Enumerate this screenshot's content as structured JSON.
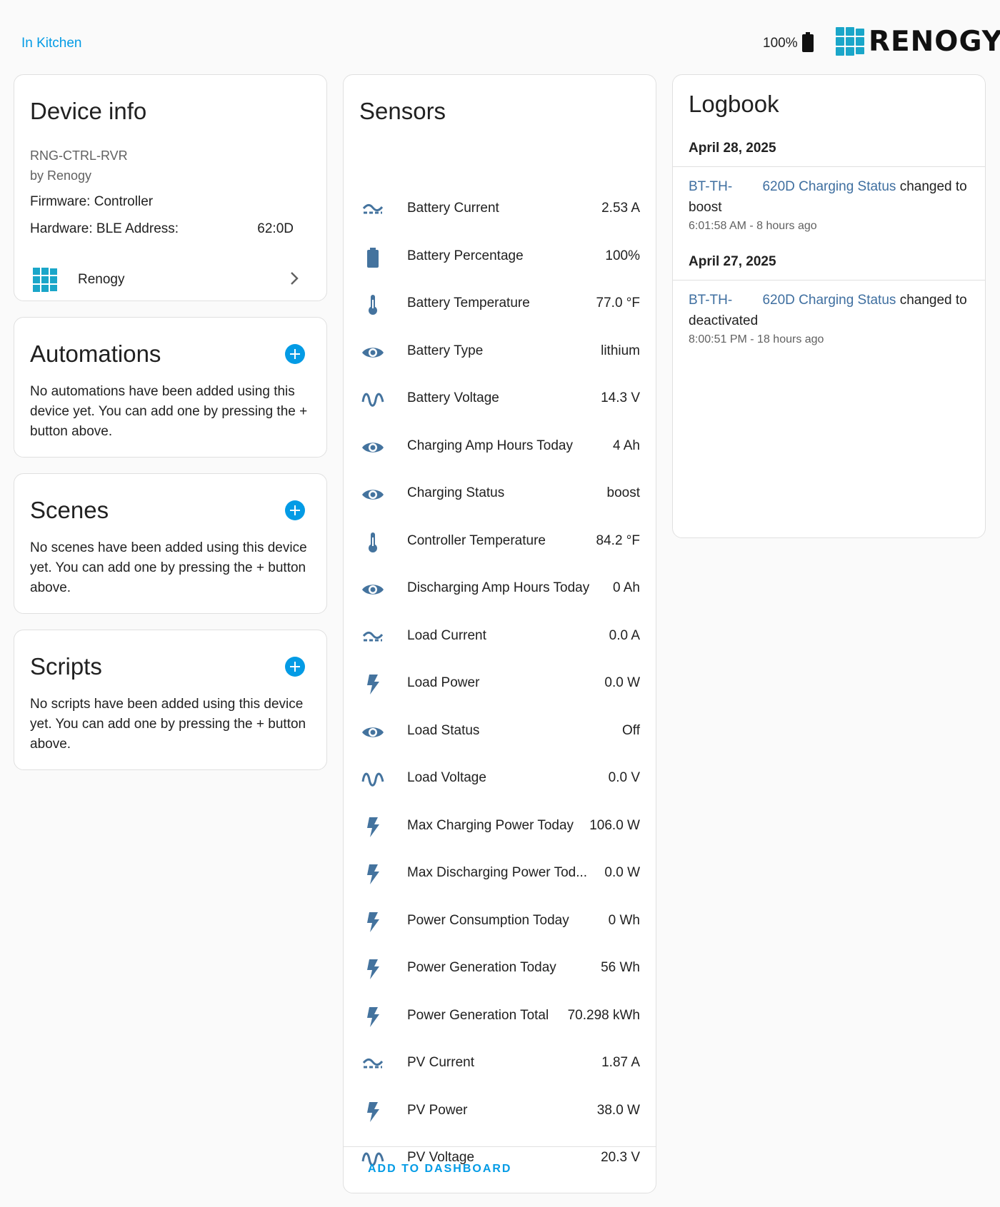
{
  "header": {
    "area_link": "In Kitchen",
    "battery_percent": "100%",
    "logo_text": "RENOGY",
    "colors": {
      "accent": "#039be5",
      "icon": "#44739e",
      "logo_teal": "#1aa6c9"
    }
  },
  "device_info": {
    "title": "Device info",
    "model": "RNG-CTRL-RVR",
    "manufacturer_by": "by Renogy",
    "firmware": "Firmware: Controller",
    "hardware_label": "Hardware: BLE Address:",
    "hardware_value": "62:0D",
    "manufacturer_link": "Renogy"
  },
  "automations": {
    "title": "Automations",
    "text": "No automations have been added using this device yet. You can add one by pressing the + button above."
  },
  "scenes": {
    "title": "Scenes",
    "text": "No scenes have been added using this device yet. You can add one by pressing the + button above."
  },
  "scripts": {
    "title": "Scripts",
    "text": "No scripts have been added using this device yet. You can add one by pressing the + button above."
  },
  "sensors": {
    "title": "Sensors",
    "footer_button": "ADD TO DASHBOARD",
    "items": [
      {
        "icon": "current-icon",
        "name": "Battery Current",
        "value": "2.53 A"
      },
      {
        "icon": "battery-icon",
        "name": "Battery Percentage",
        "value": "100%"
      },
      {
        "icon": "thermometer-icon",
        "name": "Battery Temperature",
        "value": "77.0 °F"
      },
      {
        "icon": "eye-icon",
        "name": "Battery Type",
        "value": "lithium"
      },
      {
        "icon": "voltage-icon",
        "name": "Battery Voltage",
        "value": "14.3 V"
      },
      {
        "icon": "eye-icon",
        "name": "Charging Amp Hours Today",
        "value": "4 Ah"
      },
      {
        "icon": "eye-icon",
        "name": "Charging Status",
        "value": "boost"
      },
      {
        "icon": "thermometer-icon",
        "name": "Controller Temperature",
        "value": "84.2 °F"
      },
      {
        "icon": "eye-icon",
        "name": "Discharging Amp Hours Today",
        "value": "0 Ah"
      },
      {
        "icon": "current-icon",
        "name": "Load Current",
        "value": "0.0 A"
      },
      {
        "icon": "flash-icon",
        "name": "Load Power",
        "value": "0.0 W"
      },
      {
        "icon": "eye-icon",
        "name": "Load Status",
        "value": "Off"
      },
      {
        "icon": "voltage-icon",
        "name": "Load Voltage",
        "value": "0.0 V"
      },
      {
        "icon": "flash-icon",
        "name": "Max Charging Power Today",
        "value": "106.0 W"
      },
      {
        "icon": "flash-icon",
        "name": "Max Discharging Power Tod...",
        "value": "0.0 W"
      },
      {
        "icon": "flash-icon",
        "name": "Power Consumption Today",
        "value": "0 Wh"
      },
      {
        "icon": "flash-icon",
        "name": "Power Generation Today",
        "value": "56 Wh"
      },
      {
        "icon": "flash-icon",
        "name": "Power Generation Total",
        "value": "70.298 kWh"
      },
      {
        "icon": "current-icon",
        "name": "PV Current",
        "value": "1.87 A"
      },
      {
        "icon": "flash-icon",
        "name": "PV Power",
        "value": "38.0 W"
      },
      {
        "icon": "voltage-icon",
        "name": "PV Voltage",
        "value": "20.3 V"
      }
    ]
  },
  "logbook": {
    "title": "Logbook",
    "entries": [
      {
        "date": "April 28, 2025",
        "device": "BT-TH-",
        "entity": "620D Charging Status",
        "message": "changed to",
        "state": "boost",
        "time": "6:01:58 AM - 8 hours ago"
      },
      {
        "date": "April 27, 2025",
        "device": "BT-TH-",
        "entity": "620D Charging Status",
        "message": "changed to",
        "state": "deactivated",
        "time": "8:00:51 PM - 18 hours ago"
      }
    ]
  }
}
